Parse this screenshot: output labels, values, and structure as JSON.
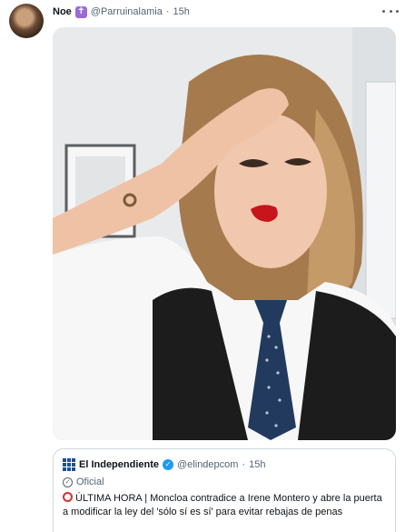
{
  "tweet": {
    "author": {
      "display_name": "Noe",
      "badge_icon": "latin-cross-icon",
      "badge_glyph": "✝",
      "handle": "@Parruinalamia",
      "separator": "·",
      "time": "15h"
    },
    "more_icon": "more-horizontal-icon",
    "media": {
      "description": "selfie photo"
    },
    "quote": {
      "author_name": "El Independiente",
      "verified_glyph": "✓",
      "handle": "@elindepcom",
      "separator": "·",
      "time": "15h",
      "label": "Oficial",
      "label_glyph": "✓",
      "text": "ÚLTIMA HORA | Moncloa contradice a Irene Montero y abre la puerta a modificar la ley del 'sólo sí es sí' para evitar rebajas de penas"
    }
  },
  "colors": {
    "text_primary": "#0f1419",
    "text_secondary": "#536471",
    "border": "#cfd9de",
    "verified": "#1d9bf0",
    "badge": "#9b6bd6",
    "alert_red": "#d53032"
  }
}
